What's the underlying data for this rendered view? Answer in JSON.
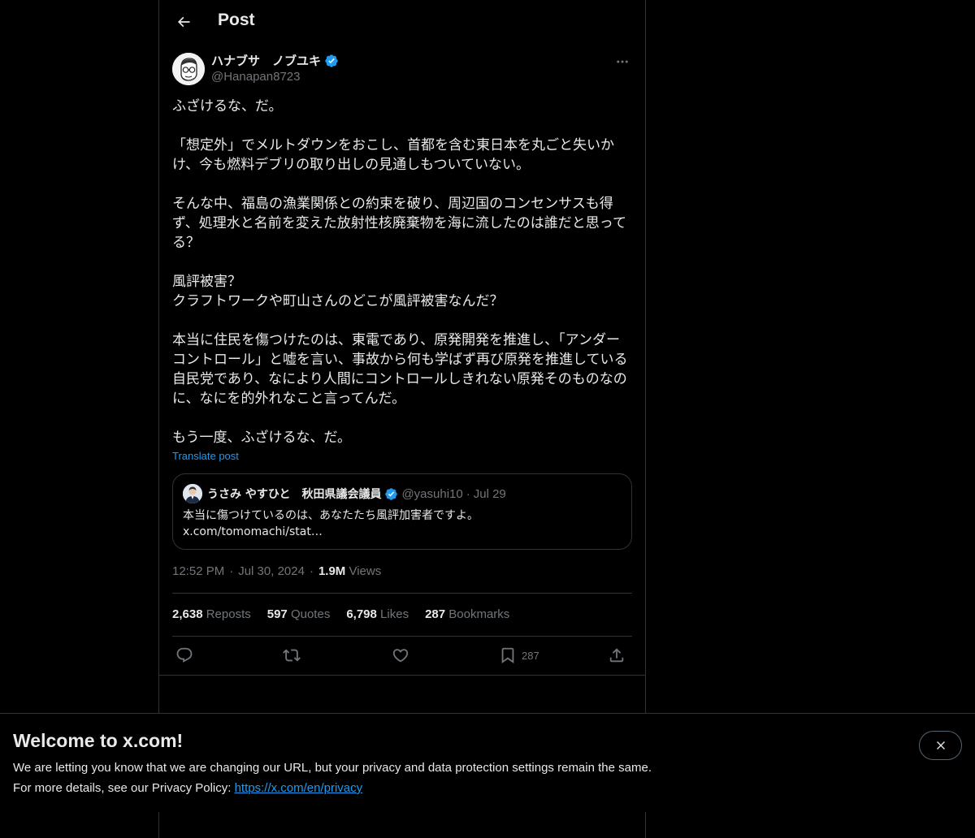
{
  "header": {
    "title": "Post"
  },
  "author": {
    "name": "ハナブサ　ノブユキ",
    "handle": "@Hanapan8723",
    "verified": true
  },
  "post": {
    "text": "ふざけるな、だ。\n\n「想定外」でメルトダウンをおこし、首都を含む東日本を丸ごと失いかけ、今も燃料デブリの取り出しの見通しもついていない。\n\nそんな中、福島の漁業関係との約束を破り、周辺国のコンセンサスも得ず、処理水と名前を変えた放射性核廃棄物を海に流したのは誰だと思ってる？\n\n風評被害？\nクラフトワークや町山さんのどこが風評被害なんだ？\n\n本当に住民を傷つけたのは、東電であり、原発開発を推進し、「アンダーコントロール」と嘘を言い、事故から何も学ばず再び原発を推進している自民党であり、なにより人間にコントロールしきれない原発そのものなのに、なにを的外れなこと言ってんだ。\n\nもう一度、ふざけるな、だ。",
    "translate_label": "Translate post"
  },
  "quote": {
    "name": "うさみ やすひと　秋田県議会議員",
    "handle": "@yasuhi10",
    "separator": "·",
    "date": "Jul 29",
    "text_line1": "本当に傷つけているのは、あなたたち風評加害者ですよ。",
    "text_line2": "x.com/tomomachi/stat…"
  },
  "meta": {
    "time": "12:52 PM",
    "separator": "·",
    "date": "Jul 30, 2024",
    "views_count": "1.9M",
    "views_label": "Views"
  },
  "stats": {
    "reposts_count": "2,638",
    "reposts_label": "Reposts",
    "quotes_count": "597",
    "quotes_label": "Quotes",
    "likes_count": "6,798",
    "likes_label": "Likes",
    "bookmarks_count": "287",
    "bookmarks_label": "Bookmarks"
  },
  "actions": {
    "reply_icon": "reply-icon",
    "repost_icon": "repost-icon",
    "like_icon": "heart-icon",
    "bookmark_icon": "bookmark-icon",
    "bookmark_count": "287",
    "share_icon": "share-icon"
  },
  "banner": {
    "title": "Welcome to x.com!",
    "line1": "We are letting you know that we are changing our URL, but your privacy and data protection settings remain the same.",
    "line2_prefix": "For more details, see our Privacy Policy: ",
    "link_text": "https://x.com/en/privacy"
  },
  "colors": {
    "background": "#000000",
    "text": "#e7e9ea",
    "secondary_text": "#71767b",
    "accent": "#1d9bf0",
    "border": "#2f3336"
  }
}
